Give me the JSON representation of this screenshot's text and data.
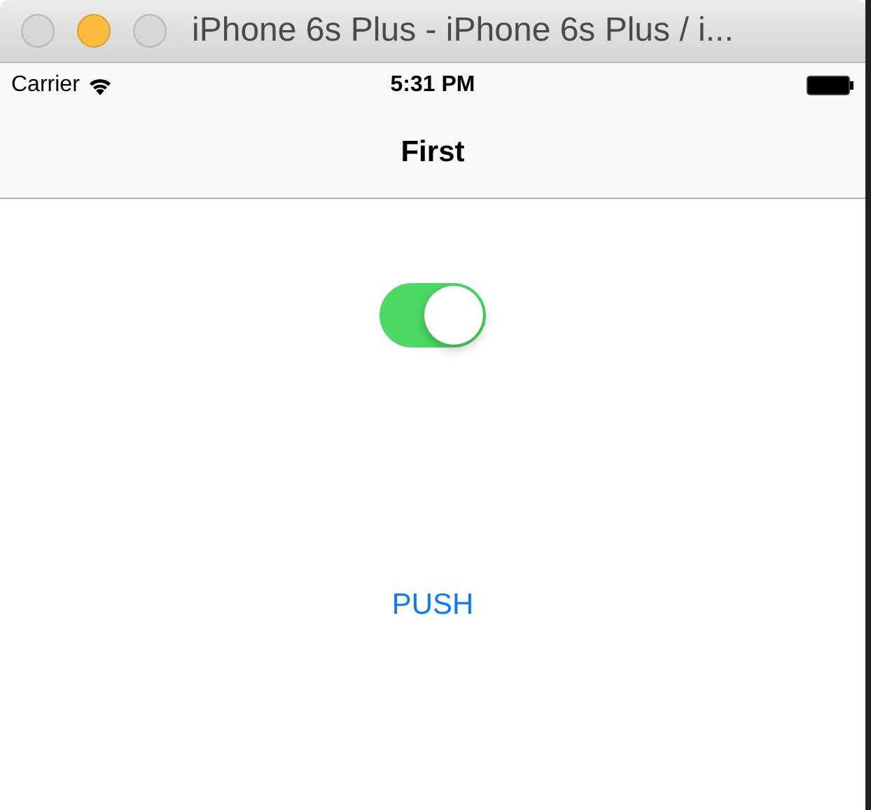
{
  "window": {
    "title": "iPhone 6s Plus - iPhone 6s Plus / i...",
    "lights": [
      {
        "color": "#d8d6d8"
      },
      {
        "color": "#fdbc40"
      },
      {
        "color": "#d8d6d8"
      }
    ]
  },
  "status_bar": {
    "carrier": "Carrier",
    "time": "5:31 PM"
  },
  "nav_bar": {
    "title": "First"
  },
  "switch": {
    "on": true
  },
  "button": {
    "label": "PUSH"
  }
}
